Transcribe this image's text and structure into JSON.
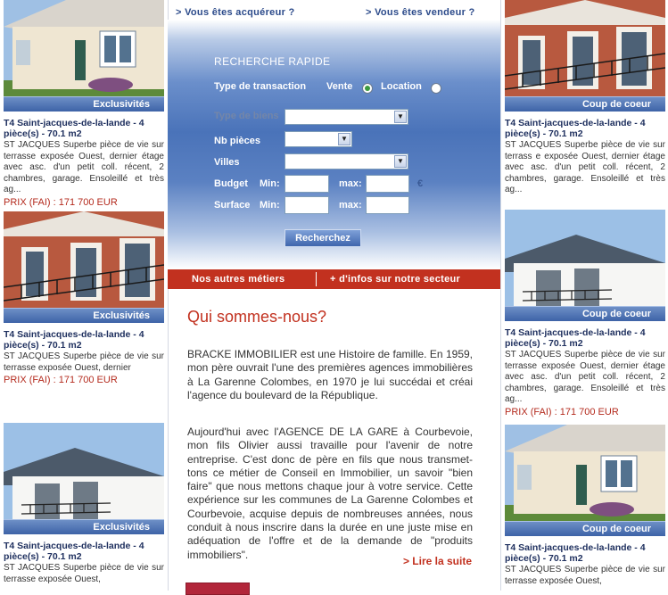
{
  "topnav": {
    "buyer": "> Vous êtes acquéreur ?",
    "seller": "> Vous êtes vendeur ?"
  },
  "search": {
    "title": "RECHERCHE RAPIDE",
    "transaction_label": "Type de transaction",
    "vente": "Vente",
    "location": "Location",
    "type_biens": "Type de biens",
    "nb_pieces": "Nb pièces",
    "villes": "Villes",
    "budget": "Budget",
    "surface": "Surface",
    "min": "Min:",
    "max": "max:",
    "currency": "€",
    "submit": "Recherchez"
  },
  "redbar": {
    "metiers": "Nos autres métiers",
    "secteur": "+ d'infos sur notre secteur"
  },
  "about": {
    "title": "Qui sommes-nous?",
    "p1": "BRACKE IMMOBILIER est une Histoire de famille. En 1959, mon père ouvrait l'une des premières agences immobilières à La Garenne Colombes, en 1970 je lui succédai et créai l'agence du boulevard de la Répub­lique.",
    "p2": "Aujourd'hui avec l'AGENCE DE LA GARE à Courbevoie, mon fils Olivier aussi travaille pour l'avenir de notre entreprise. C'est donc de père en fils que nous transmet­tons ce métier de Conseil en Immobilier, un savoir \"bien faire\" que nous mettons chaque jour à votre service. Cette expérience sur les communes de La Garenne Colombes et Courbevoie, acquise depuis de nom­breuses années, nous conduit à nous inscrire dans la durée en une juste mise en adéquation de l'offre et de la demande de \"produits immobiliers\".",
    "readmore": "> Lire la suite"
  },
  "left_listings": [
    {
      "label": "Exclusivités",
      "title": "T4 Saint-jacques-de-la-lande - 4 pièce(s) - 70.1 m2",
      "desc": "ST JACQUES Superbe pièce de vie sur terrasse exposée Ouest, dernier étage avec asc. d'un petit coll. récent, 2 chambres, garage. Ensoleillé et très ag...",
      "price": "PRIX (FAI) : 171 700 EUR"
    },
    {
      "label": "Exclusivités",
      "title": "T4 Saint-jacques-de-la-lande - 4 pièce(s) - 70.1 m2",
      "desc": "ST JACQUES Superbe pièce de vie sur terrasse exposée Ouest, dernier",
      "price": "PRIX (FAI) : 171 700 EUR"
    },
    {
      "label": "Exclusivités",
      "title": "T4 Saint-jacques-de-la-lande - 4 pièce(s) - 70.1 m2",
      "desc": "ST JACQUES Superbe pièce de vie sur terrasse exposée Ouest,",
      "price": ""
    }
  ],
  "right_listings": [
    {
      "label": "Coup de coeur",
      "title": "T4 Saint-jacques-de-la-lande - 4 pièce(s) - 70.1 m2",
      "desc": "ST JACQUES Superbe pièce de vie sur terrass e exposée Ouest, dernier étage avec asc. d'un petit coll. récent, 2 chambres, garage. Ensoleillé et très ag...",
      "price": ""
    },
    {
      "label": "Coup de coeur",
      "title": "T4 Saint-jacques-de-la-lande - 4 pièce(s) - 70.1 m2",
      "desc": "ST JACQUES Superbe pièce de vie sur terrasse exposée Ouest, dernier étage avec asc. d'un petit coll. récent, 2 chambres, garage. Ensoleillé et très ag...",
      "price": "PRIX (FAI) : 171 700 EUR"
    },
    {
      "label": "Coup de coeur",
      "title": "T4 Saint-jacques-de-la-lande - 4 pièce(s) - 70.1 m2",
      "desc": "ST JACQUES Superbe pièce de vie sur terrasse exposée Ouest,",
      "price": ""
    }
  ],
  "colors": {
    "accent_red": "#c2311f",
    "nav_blue": "#2b4a8a",
    "label_blue": "#3d63a7"
  }
}
